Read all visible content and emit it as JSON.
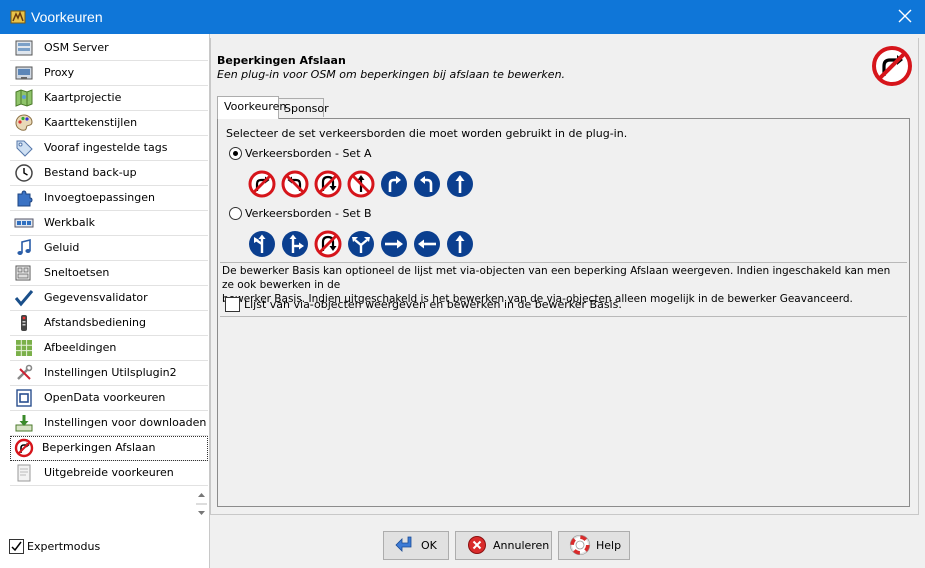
{
  "window": {
    "title": "Voorkeuren"
  },
  "sidebar": {
    "items": [
      {
        "label": "OSM Server",
        "icon": "osm-server-icon"
      },
      {
        "label": "Proxy",
        "icon": "proxy-icon"
      },
      {
        "label": "Kaartprojectie",
        "icon": "map-projection-icon"
      },
      {
        "label": "Kaarttekenstijlen",
        "icon": "palette-icon"
      },
      {
        "label": "Vooraf ingestelde tags",
        "icon": "tag-icon"
      },
      {
        "label": "Bestand back-up",
        "icon": "clock-icon"
      },
      {
        "label": "Invoegtoepassingen",
        "icon": "plugin-icon"
      },
      {
        "label": "Werkbalk",
        "icon": "toolbar-icon"
      },
      {
        "label": "Geluid",
        "icon": "music-note-icon"
      },
      {
        "label": "Sneltoetsen",
        "icon": "keyboard-icon"
      },
      {
        "label": "Gegevensvalidator",
        "icon": "checkmark-icon"
      },
      {
        "label": "Afstandsbediening",
        "icon": "remote-control-icon"
      },
      {
        "label": "Afbeeldingen",
        "icon": "imagery-grid-icon"
      },
      {
        "label": "Instellingen Utilsplugin2",
        "icon": "tools-icon"
      },
      {
        "label": "OpenData voorkeuren",
        "icon": "opendata-icon"
      },
      {
        "label": "Instellingen voor downloaden",
        "icon": "download-icon"
      },
      {
        "label": "Beperkingen Afslaan",
        "icon": "turn-restriction-icon"
      },
      {
        "label": "Uitgebreide voorkeuren",
        "icon": "advanced-preferences-icon"
      }
    ],
    "selected_index": 16,
    "expert_mode_label": "Expertmodus",
    "expert_mode_checked": true
  },
  "panel": {
    "title": "Beperkingen Afslaan",
    "description": "Een plug-in voor OSM om beperkingen bij afslaan te bewerken.",
    "tabs": [
      {
        "label": "Voorkeuren",
        "active": true
      },
      {
        "label": "Sponsor",
        "active": false
      }
    ],
    "prompt": "Selecteer de set verkeersborden die moet worden gebruikt in de plug-in.",
    "set_a": {
      "label": "Verkeersborden - Set A",
      "selected": true,
      "signs": [
        "no-right-turn-sign-icon",
        "no-left-turn-sign-icon",
        "no-u-turn-sign-icon",
        "no-straight-on-sign-icon",
        "only-right-turn-sign-icon",
        "only-left-turn-sign-icon",
        "only-straight-on-sign-icon"
      ]
    },
    "set_b": {
      "label": "Verkeersborden - Set B",
      "selected": false,
      "signs": [
        "only-left-turn-sign-icon",
        "only-right-turn-sign-icon",
        "no-u-turn-sign-icon",
        "only-left-or-right-sign-icon",
        "only-right-arrow-sign-icon",
        "only-left-arrow-sign-icon",
        "only-straight-on-sign-icon"
      ]
    },
    "basic_editor_desc_line1": "De bewerker Basis kan optioneel de lijst met via-objecten van een beperking Afslaan weergeven. Indien ingeschakeld kan men ze ook bewerken in de",
    "basic_editor_desc_line2": "bewerker Basis. Indien uitgeschakeld is het bewerken van de via-objecten alleen mogelijk in de bewerker Geavanceerd.",
    "via_objects_label": "Lijst van via-objecten weergeven en bewerken in de bewerker Basis.",
    "via_objects_checked": false
  },
  "buttons": {
    "ok_label": "OK",
    "cancel_label": "Annuleren",
    "help_label": "Help"
  },
  "colors": {
    "titlebar": "#0f76d8",
    "sign_red": "#d6151b",
    "sign_blue": "#0b3f8f"
  }
}
